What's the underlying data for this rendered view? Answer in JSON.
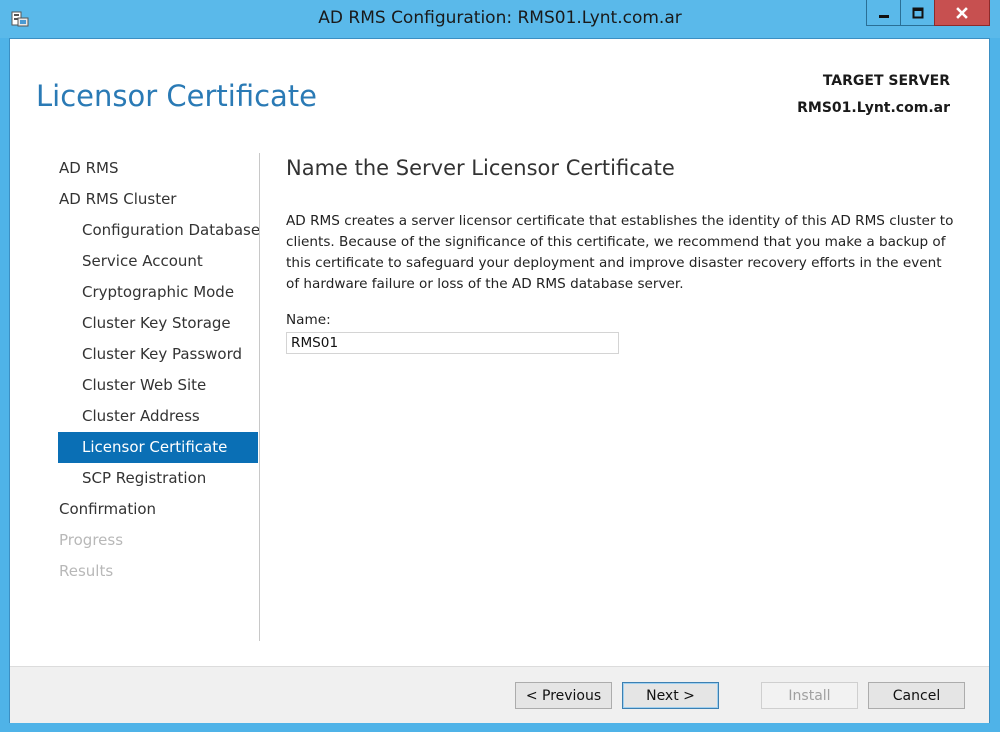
{
  "window": {
    "title": "AD RMS Configuration: RMS01.Lynt.com.ar",
    "controls": {
      "minimize": "minimize-icon",
      "maximize": "maximize-icon",
      "close": "close-icon"
    }
  },
  "header": {
    "page_title": "Licensor Certificate",
    "target_label": "TARGET SERVER",
    "target_server": "RMS01.Lynt.com.ar"
  },
  "nav": {
    "items": [
      {
        "label": "AD RMS",
        "level": 0,
        "state": "normal"
      },
      {
        "label": "AD RMS Cluster",
        "level": 0,
        "state": "normal"
      },
      {
        "label": "Configuration Database",
        "level": 1,
        "state": "normal"
      },
      {
        "label": "Service Account",
        "level": 1,
        "state": "normal"
      },
      {
        "label": "Cryptographic Mode",
        "level": 1,
        "state": "normal"
      },
      {
        "label": "Cluster Key Storage",
        "level": 1,
        "state": "normal"
      },
      {
        "label": "Cluster Key Password",
        "level": 1,
        "state": "normal"
      },
      {
        "label": "Cluster Web Site",
        "level": 1,
        "state": "normal"
      },
      {
        "label": "Cluster Address",
        "level": 1,
        "state": "normal"
      },
      {
        "label": "Licensor Certificate",
        "level": 1,
        "state": "active"
      },
      {
        "label": "SCP Registration",
        "level": 1,
        "state": "normal"
      },
      {
        "label": "Confirmation",
        "level": 0,
        "state": "normal"
      },
      {
        "label": "Progress",
        "level": 0,
        "state": "disabled"
      },
      {
        "label": "Results",
        "level": 0,
        "state": "disabled"
      }
    ]
  },
  "main": {
    "heading": "Name the Server Licensor Certificate",
    "description": "AD RMS creates a server licensor certificate that establishes the identity of this AD RMS cluster to clients. Because of the significance of this certificate, we recommend that you make a backup of this certificate to safeguard your deployment and improve disaster recovery efforts in the event of hardware failure or loss of the AD RMS database server.",
    "name_label": "Name:",
    "name_value": "RMS01"
  },
  "footer": {
    "previous_label": "< Previous",
    "next_label": "Next >",
    "install_label": "Install",
    "cancel_label": "Cancel"
  },
  "colors": {
    "accent": "#2a7ab5",
    "active_nav": "#0a6fb5",
    "frame": "#5ab9ea",
    "close_button": "#c75050"
  }
}
